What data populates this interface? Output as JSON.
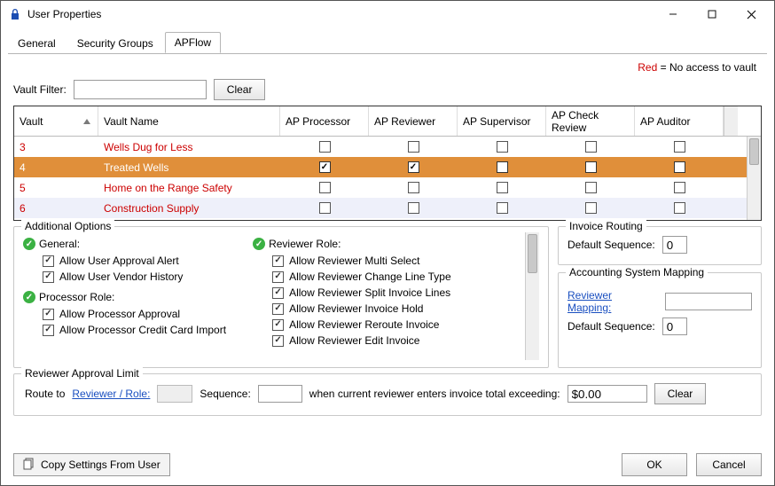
{
  "window": {
    "title": "User Properties"
  },
  "tabs": [
    "General",
    "Security Groups",
    "APFlow"
  ],
  "active_tab": 2,
  "legend": {
    "red": "Red",
    "text": "  = No access to vault"
  },
  "filter": {
    "label": "Vault Filter:",
    "value": "",
    "clear": "Clear"
  },
  "grid": {
    "columns": [
      "Vault",
      "Vault Name",
      "AP Processor",
      "AP Reviewer",
      "AP Supervisor",
      "AP Check Review",
      "AP Auditor"
    ],
    "rows": [
      {
        "vault": "3",
        "name": "Wells Dug for Less",
        "pp": false,
        "rv": false,
        "sv": false,
        "ck": false,
        "au": false,
        "red": true,
        "sel": false,
        "alt": false
      },
      {
        "vault": "4",
        "name": "Treated Wells",
        "pp": true,
        "rv": true,
        "sv": false,
        "ck": false,
        "au": false,
        "red": false,
        "sel": true,
        "alt": false
      },
      {
        "vault": "5",
        "name": "Home on the Range Safety",
        "pp": false,
        "rv": false,
        "sv": false,
        "ck": false,
        "au": false,
        "red": true,
        "sel": false,
        "alt": false
      },
      {
        "vault": "6",
        "name": "Construction Supply",
        "pp": false,
        "rv": false,
        "sv": false,
        "ck": false,
        "au": false,
        "red": true,
        "sel": false,
        "alt": true
      }
    ]
  },
  "options": {
    "panel_title": "Additional Options",
    "groups": [
      {
        "title": "General:",
        "items": [
          {
            "label": "Allow User Approval Alert",
            "checked": true
          },
          {
            "label": "Allow User Vendor History",
            "checked": true
          }
        ]
      },
      {
        "title": "Processor Role:",
        "items": [
          {
            "label": "Allow Processor Approval",
            "checked": true
          },
          {
            "label": "Allow Processor Credit Card Import",
            "checked": true
          }
        ]
      }
    ],
    "reviewer": {
      "title": "Reviewer Role:",
      "items": [
        {
          "label": "Allow Reviewer Multi Select",
          "checked": true
        },
        {
          "label": "Allow Reviewer Change Line Type",
          "checked": true
        },
        {
          "label": "Allow Reviewer Split Invoice Lines",
          "checked": true
        },
        {
          "label": "Allow Reviewer Invoice Hold",
          "checked": true
        },
        {
          "label": "Allow Reviewer Reroute Invoice",
          "checked": true
        },
        {
          "label": "Allow Reviewer Edit Invoice",
          "checked": true
        }
      ]
    }
  },
  "routing": {
    "title": "Invoice Routing",
    "seq_label": "Default Sequence:",
    "seq_value": "0"
  },
  "mapping": {
    "title": "Accounting System Mapping",
    "link": "Reviewer Mapping:",
    "map_value": "",
    "seq_label": "Default Sequence:",
    "seq_value": "0"
  },
  "revlimit": {
    "title": "Reviewer Approval Limit",
    "route_to": "Route to",
    "reviewer_link": "Reviewer / Role:",
    "sequence_label": "Sequence:",
    "sequence_value": "",
    "cond_text": "when current reviewer enters invoice total exceeding:",
    "amount": "$0.00",
    "clear": "Clear"
  },
  "footer": {
    "copy": "Copy Settings From User",
    "ok": "OK",
    "cancel": "Cancel"
  }
}
